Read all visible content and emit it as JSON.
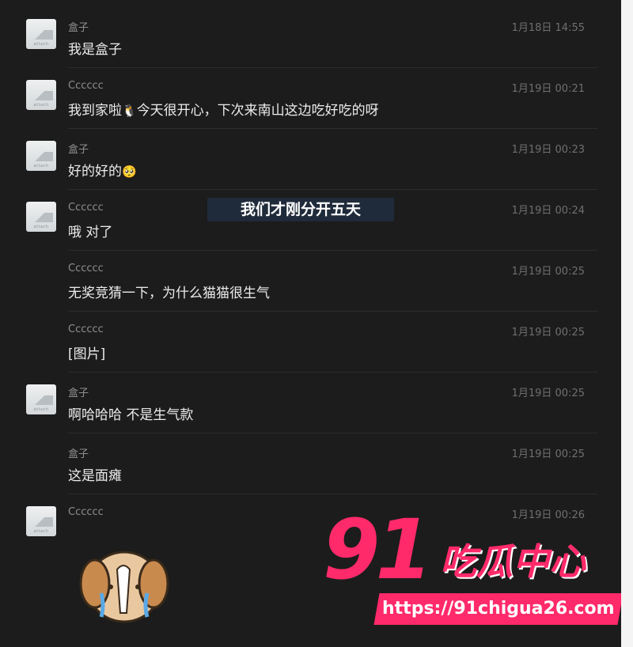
{
  "messages": [
    {
      "sender": "盒子",
      "time": "1月18日 14:55",
      "text": "我是盒子",
      "avatar": true
    },
    {
      "sender": "Cccccc",
      "time": "1月19日 00:21",
      "text_before": "我到家啦",
      "emoji": "🐧",
      "text_after": "今天很开心，下次来南山这边吃好吃的呀",
      "avatar": true
    },
    {
      "sender": "盒子",
      "time": "1月19日 00:23",
      "text_before": "好的好的",
      "emoji": "🥺",
      "avatar": true
    },
    {
      "sender": "Cccccc",
      "time": "1月19日 00:24",
      "text": "哦 对了",
      "avatar": true
    },
    {
      "sender": "Cccccc",
      "time": "1月19日 00:25",
      "text": "无奖竞猜一下，为什么猫猫很生气",
      "avatar": false
    },
    {
      "sender": "Cccccc",
      "time": "1月19日 00:25",
      "text": "[图片]",
      "avatar": false
    },
    {
      "sender": "盒子",
      "time": "1月19日 00:25",
      "text": "啊哈哈哈 不是生气款",
      "avatar": true
    },
    {
      "sender": "盒子",
      "time": "1月19日 00:25",
      "text": "这是面瘫",
      "avatar": false
    },
    {
      "sender": "Cccccc",
      "time": "1月19日 00:26",
      "avatar": true
    }
  ],
  "avatar_label": "attach",
  "overlay_caption": "我们才刚分开五天",
  "watermark": {
    "number": "91",
    "title": "吃瓜中心",
    "url": "https://91chigua26.com",
    "color": "#ff2a6a"
  },
  "icons": {
    "avatar": "image-placeholder-icon",
    "sticker": "crying-dog-sticker"
  }
}
